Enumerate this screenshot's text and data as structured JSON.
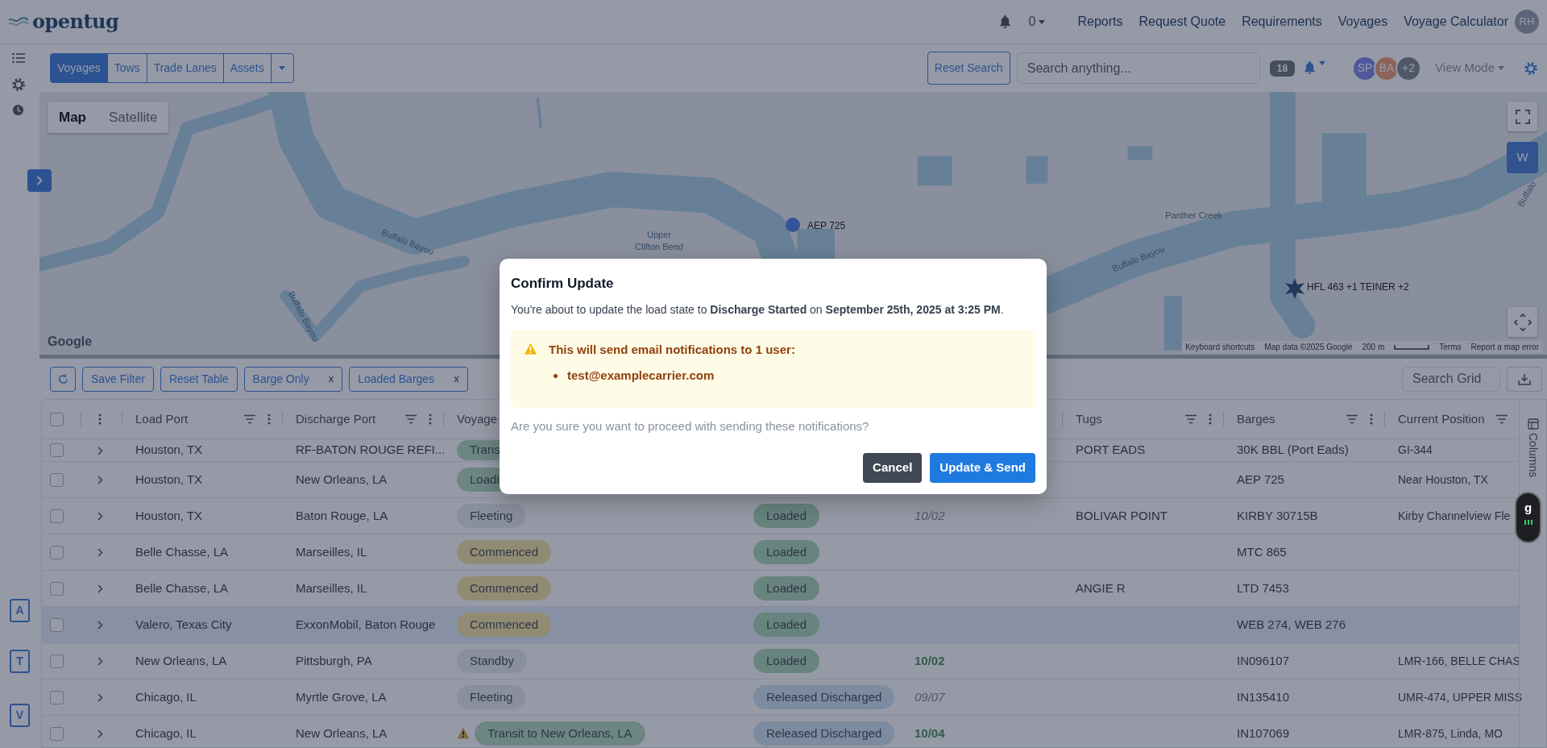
{
  "navbar": {
    "logo": "opentug",
    "notifications_count": "0",
    "links": [
      "Reports",
      "Request Quote",
      "Requirements",
      "Voyages",
      "Voyage Calculator"
    ],
    "user_initials": "RH"
  },
  "toolbar": {
    "tabs": [
      {
        "label": "Voyages",
        "selected": true
      },
      {
        "label": "Tows",
        "selected": false
      },
      {
        "label": "Trade Lanes",
        "selected": false
      },
      {
        "label": "Assets",
        "selected": false
      }
    ],
    "reset_button": "Reset Search",
    "search": {
      "placeholder": "Search anything..."
    },
    "alert_count": "18",
    "avatars": [
      {
        "initials": "SP",
        "color": "#4e599c"
      },
      {
        "initials": "BA",
        "color": "#8d6359"
      },
      {
        "initials": "+2",
        "color": "#4f5869"
      }
    ],
    "view_mode": "View Mode"
  },
  "sidebar": {
    "letters": [
      "A",
      "T",
      "V"
    ]
  },
  "map": {
    "map_types": [
      {
        "label": "Map",
        "selected": true
      },
      {
        "label": "Satellite",
        "selected": false
      }
    ],
    "labels": [
      "Buffalo Bayou",
      "Upper",
      "Clifton Bend",
      "Buffalo Bayou",
      "Buffalo Bayou",
      "Panther Creek",
      "Buffalo"
    ],
    "markers": [
      {
        "label": "AEP 725",
        "kind": "dot"
      },
      {
        "label": "HFL 463 +1 TEINER +2",
        "kind": "cluster"
      }
    ],
    "layer_button": "W",
    "logo": "Google",
    "footer": [
      "Keyboard shortcuts",
      "Map data ©2025 Google",
      "200 m",
      "Terms",
      "Report a map error"
    ]
  },
  "grid": {
    "chips": [
      {
        "label": "Save Filter",
        "removable": false
      },
      {
        "label": "Reset Table",
        "removable": false
      },
      {
        "label": "Barge Only",
        "removable": true,
        "remove": "x"
      },
      {
        "label": "Loaded Barges",
        "removable": true,
        "remove": "x"
      }
    ],
    "search": {
      "placeholder": "Search Grid"
    },
    "select_all": {
      "checked": false
    },
    "columns": [
      {
        "label": "Load Port"
      },
      {
        "label": "Discharge Port"
      },
      {
        "label": "Voyage"
      },
      null,
      null,
      {
        "label": "Tugs"
      },
      {
        "label": "Barges"
      },
      {
        "label": "Current Position"
      }
    ],
    "rows": [
      {
        "checked": false,
        "highlighted": false,
        "load_port": "Houston, TX",
        "discharge_port": "RF-BATON ROUGE REFI...",
        "voyage": {
          "label": "Trans",
          "color": "#6c8783",
          "warning": false
        },
        "tugs": "PORT EADS",
        "barges": "30K BBL (Port Eads)",
        "current_position": "GI-344"
      },
      {
        "checked": false,
        "highlighted": false,
        "load_port": "Houston, TX",
        "discharge_port": "New Orleans, LA",
        "voyage": {
          "label": "Loadi",
          "color": "#6c8783",
          "warning": false
        },
        "barges": "AEP 725",
        "current_position": "Near Houston, TX"
      },
      {
        "checked": false,
        "highlighted": false,
        "load_port": "Houston, TX",
        "discharge_port": "Baton Rouge, LA",
        "voyage": {
          "label": "Fleeting",
          "color": "#8a909e",
          "warning": false
        },
        "column_5": {
          "label": "Loaded",
          "color": "#67857e"
        },
        "column_6": {
          "text": "10/02",
          "kind": "estimated"
        },
        "tugs": "BOLIVAR POINT",
        "barges": "KIRBY 30715B",
        "current_position": "Kirby Channelview Fle"
      },
      {
        "checked": false,
        "highlighted": false,
        "load_port": "Belle Chasse, LA",
        "discharge_port": "Marseilles, IL",
        "voyage": {
          "label": "Commenced",
          "color": "#918b75",
          "warning": false
        },
        "column_5": {
          "label": "Loaded",
          "color": "#67857e"
        },
        "barges": "MTC 865"
      },
      {
        "checked": false,
        "highlighted": false,
        "load_port": "Belle Chasse, LA",
        "discharge_port": "Marseilles, IL",
        "voyage": {
          "label": "Commenced",
          "color": "#918b75",
          "warning": false
        },
        "column_5": {
          "label": "Loaded",
          "color": "#67857e"
        },
        "tugs": "ANGIE R",
        "barges": "LTD 7453"
      },
      {
        "checked": false,
        "highlighted": true,
        "load_port": "Valero, Texas City",
        "discharge_port": "ExxonMobil, Baton Rouge",
        "voyage": {
          "label": "Commenced",
          "color": "#918b75",
          "warning": false
        },
        "column_5": {
          "label": "Loaded",
          "color": "#67857e"
        },
        "barges": "WEB 274, WEB 276"
      },
      {
        "checked": false,
        "highlighted": false,
        "load_port": "New Orleans, LA",
        "discharge_port": "Pittsburgh, PA",
        "voyage": {
          "label": "Standby",
          "color": "#8a909e",
          "warning": false
        },
        "column_5": {
          "label": "Loaded",
          "color": "#67857e"
        },
        "column_6": {
          "text": "10/02",
          "kind": "confirmed"
        },
        "barges": "IN096107",
        "current_position": "LMR-166, BELLE CHAS"
      },
      {
        "checked": false,
        "highlighted": false,
        "load_port": "Chicago, IL",
        "discharge_port": "Myrtle Grove, LA",
        "voyage": {
          "label": "Fleeting",
          "color": "#8a909e",
          "warning": false
        },
        "column_5": {
          "label": "Released Discharged",
          "color": "#7c8ca0"
        },
        "column_6": {
          "text": "09/07",
          "kind": "estimated"
        },
        "barges": "IN135410",
        "current_position": "UMR-474, UPPER MISS"
      },
      {
        "checked": false,
        "highlighted": false,
        "load_port": "Chicago, IL",
        "discharge_port": "New Orleans, LA",
        "voyage": {
          "label": "Transit to New Orleans, LA",
          "color": "#6c8783",
          "warning": true
        },
        "column_5": {
          "label": "Released Discharged",
          "color": "#7c8ca0"
        },
        "column_6": {
          "text": "10/04",
          "kind": "confirmed"
        },
        "barges": "IN107069",
        "current_position": "LMR-875, Linda, MO"
      }
    ],
    "side_panel": "Columns"
  },
  "floating_widget": {
    "label": "g"
  },
  "dialog": {
    "title": "Confirm Update",
    "message": "You're about to update the load state to **Discharge Started** on **September 25th, 2025 at 3:25 PM**.",
    "warning": {
      "heading": "This will send email notifications to 1 user:",
      "recipients": [
        "test@examplecarrier.com"
      ]
    },
    "question": "Are you sure you want to proceed with sending these notifications?",
    "buttons": [
      {
        "label": "Cancel",
        "kind": "secondary"
      },
      {
        "label": "Update & Send",
        "kind": "primary"
      }
    ]
  }
}
